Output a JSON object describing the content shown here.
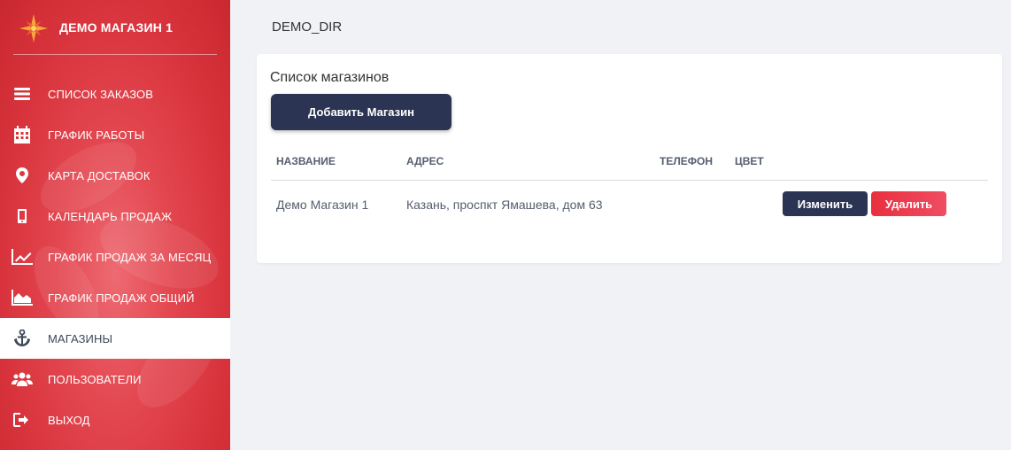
{
  "brand": {
    "name": "ДЕМО МАГАЗИН 1",
    "logo_icon": "star-logo-icon"
  },
  "sidebar": {
    "items": [
      {
        "label": "СПИСОК ЗАКАЗОВ",
        "icon": "list-icon",
        "active": false
      },
      {
        "label": "ГРАФИК РАБОТЫ",
        "icon": "calendar-icon",
        "active": false
      },
      {
        "label": "КАРТА ДОСТАВОК",
        "icon": "map-pin-icon",
        "active": false
      },
      {
        "label": "КАЛЕНДАРЬ ПРОДАЖ",
        "icon": "mobile-icon",
        "active": false
      },
      {
        "label": "ГРАФИК ПРОДАЖ ЗА МЕСЯЦ",
        "icon": "line-chart-icon",
        "active": false
      },
      {
        "label": "ГРАФИК ПРОДАЖ ОБЩИЙ",
        "icon": "area-chart-icon",
        "active": false
      },
      {
        "label": "МАГАЗИНЫ",
        "icon": "anchor-icon",
        "active": true
      },
      {
        "label": "ПОЛЬЗОВАТЕЛИ",
        "icon": "users-icon",
        "active": false
      },
      {
        "label": "ВЫХОД",
        "icon": "logout-icon",
        "active": false
      }
    ]
  },
  "header": {
    "title": "DEMO_DIR"
  },
  "main": {
    "card_title": "Список магазинов",
    "add_button": "Добавить Магазин",
    "table": {
      "columns": [
        "НАЗВАНИЕ",
        "АДРЕС",
        "ТЕЛЕФОН",
        "ЦВЕТ"
      ],
      "rows": [
        {
          "name": "Демо Магазин 1",
          "address": "Казань, проспкт Ямашева, дом 63",
          "phone": "",
          "color": "",
          "edit_label": "Изменить",
          "delete_label": "Удалить"
        }
      ]
    }
  },
  "colors": {
    "sidebar_red": "#e34750",
    "navy_button": "#2b3553",
    "danger_button": "#e8303e",
    "page_background": "#f1f2f6"
  }
}
